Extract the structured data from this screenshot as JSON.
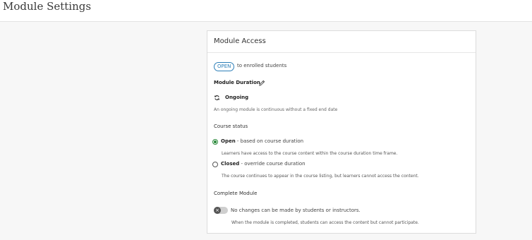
{
  "page": {
    "title": "Module Settings"
  },
  "module_access": {
    "title": "Module Access",
    "access_badge": "OPEN",
    "access_suffix": "to enrolled students",
    "duration_label": "Module Duration",
    "duration_value": "Ongoing",
    "duration_note": "An ongoing module is continuous without a fixed end date",
    "course_status": {
      "label": "Course status",
      "options": [
        {
          "title": "Open",
          "suffix": " - based on course duration",
          "description": "Learners have access to the course content within the course duration time frame.",
          "selected": true
        },
        {
          "title": "Closed",
          "suffix": " - override course duration",
          "description": "The course continues to appear in the course listing, but learners cannot access the content.",
          "selected": false
        }
      ]
    },
    "complete_module": {
      "label": "Complete Module",
      "toggle_state": false,
      "toggle_text": "No changes can be made by students or instructors.",
      "note": "When the module is completed, students can access the content but cannot participate."
    }
  },
  "colors": {
    "accent_blue": "#2d7fb8",
    "radio_green": "#2e8b3e"
  },
  "icons": {
    "edit": "pencil-icon",
    "duration": "sync-icon",
    "toggle_off": "x-icon"
  }
}
